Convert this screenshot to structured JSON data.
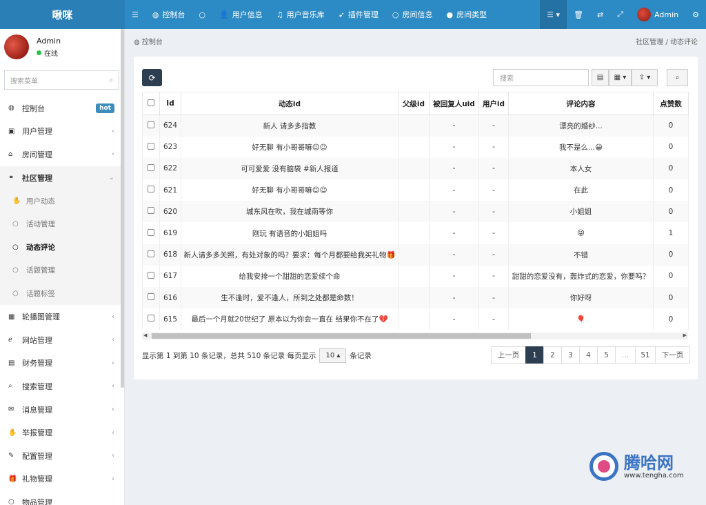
{
  "app": {
    "logo": "啾咪"
  },
  "topnav": {
    "items": [
      {
        "icon": "☰",
        "label": ""
      },
      {
        "icon": "◍",
        "label": "控制台"
      },
      {
        "icon": "○",
        "label": ""
      },
      {
        "icon": "👤",
        "label": "用户信息"
      },
      {
        "icon": "♫",
        "label": "用户音乐库"
      },
      {
        "icon": "➶",
        "label": "插件管理"
      },
      {
        "icon": "○",
        "label": "房间信息"
      },
      {
        "icon": "●",
        "label": "房间类型"
      }
    ],
    "right": {
      "menu_icon": "☰ ▾",
      "trash_icon": "🗑",
      "translate_icon": "⇄",
      "fullscreen_icon": "⤢",
      "user": "Admin",
      "settings_icon": "⚙"
    }
  },
  "sidebar": {
    "user": {
      "name": "Admin",
      "status": "在线"
    },
    "search_placeholder": "搜索菜单",
    "items": [
      {
        "icon": "◍",
        "label": "控制台",
        "badge": "hot"
      },
      {
        "icon": "▣",
        "label": "用户管理",
        "arrow": "‹"
      },
      {
        "icon": "⌂",
        "label": "房间管理",
        "arrow": "‹"
      },
      {
        "icon": "⚭",
        "label": "社区管理",
        "arrow": "⌄"
      }
    ],
    "subitems": [
      {
        "icon": "✋",
        "label": "用户动态"
      },
      {
        "icon": "○",
        "label": "活动管理"
      },
      {
        "icon": "○",
        "label": "动态评论"
      },
      {
        "icon": "○",
        "label": "话题管理"
      },
      {
        "icon": "○",
        "label": "话题标签"
      }
    ],
    "items2": [
      {
        "icon": "▦",
        "label": "轮播图管理",
        "arrow": "‹"
      },
      {
        "icon": "ℯ",
        "label": "网站管理",
        "arrow": "‹"
      },
      {
        "icon": "▤",
        "label": "财务管理",
        "arrow": "‹"
      },
      {
        "icon": "⌕",
        "label": "搜索管理",
        "arrow": "‹"
      },
      {
        "icon": "✉",
        "label": "消息管理",
        "arrow": "‹"
      },
      {
        "icon": "✋",
        "label": "举报管理",
        "arrow": "‹"
      },
      {
        "icon": "✎",
        "label": "配置管理",
        "arrow": "‹"
      },
      {
        "icon": "🎁",
        "label": "礼物管理",
        "arrow": "‹"
      },
      {
        "icon": "○",
        "label": "物品管理",
        "arrow": ""
      }
    ]
  },
  "breadcrumb": {
    "left": "◍ 控制台",
    "right": "社区管理  /  动态评论"
  },
  "toolbar": {
    "refresh_icon": "⟳",
    "search_placeholder": "搜索",
    "cols_icon": "▦ ▾",
    "list_icon": "▤",
    "export_icon": "⇪ ▾",
    "search_btn": "⌕"
  },
  "table": {
    "headers": [
      "Id",
      "动态id",
      "父级id",
      "被回复人uid",
      "用户id",
      "评论内容",
      "点赞数"
    ],
    "rows": [
      [
        "624",
        "新人 请多多指教",
        "",
        "-",
        "-",
        "漂亮的婚纱...",
        "0"
      ],
      [
        "623",
        "好无聊 有小哥哥嘛☺☺",
        "",
        "-",
        "-",
        "我不是么...😀",
        "0"
      ],
      [
        "622",
        "可可爱爱 没有脑袋 #新人报道",
        "",
        "-",
        "-",
        "本人女",
        "0"
      ],
      [
        "621",
        "好无聊 有小哥哥嘛☺☺",
        "",
        "-",
        "-",
        "在此",
        "0"
      ],
      [
        "620",
        "城东风在吹，我在城南等你",
        "",
        "-",
        "-",
        "小姐姐",
        "0"
      ],
      [
        "619",
        "刚玩 有语音的小姐姐吗",
        "",
        "-",
        "-",
        "😜",
        "1"
      ],
      [
        "618",
        "新人请多多关照，有处对象的吗？要求：每个月都要给我买礼物🎁",
        "",
        "-",
        "-",
        "不错",
        "0"
      ],
      [
        "617",
        "给我安排一个甜甜的恋爱续个命",
        "",
        "-",
        "-",
        "甜甜的恋爱没有，轰炸式的恋爱，你要吗？",
        "0"
      ],
      [
        "616",
        "生不逢时，爱不逢人，所到之处都是命数！",
        "",
        "-",
        "-",
        "你好呀",
        "0"
      ],
      [
        "615",
        "最后一个月就20世纪了 原本以为你会一直在 结果你不在了💔",
        "",
        "-",
        "-",
        "🎈",
        "0"
      ]
    ]
  },
  "footer": {
    "info_prefix": "显示第 1 到第 10 条记录，总共 510 条记录 每页显示",
    "page_size": "10 ▴",
    "info_suffix": "条记录"
  },
  "pagination": [
    "上一页",
    "1",
    "2",
    "3",
    "4",
    "5",
    "...",
    "51",
    "下一页"
  ],
  "watermark": {
    "title": "腾哈网",
    "url": "www.tengha.com"
  },
  "colors": {
    "topbar": "#2c8ac4",
    "accent": "#2c3e50",
    "hot": "#3c8dbc",
    "online": "#27c24c"
  }
}
